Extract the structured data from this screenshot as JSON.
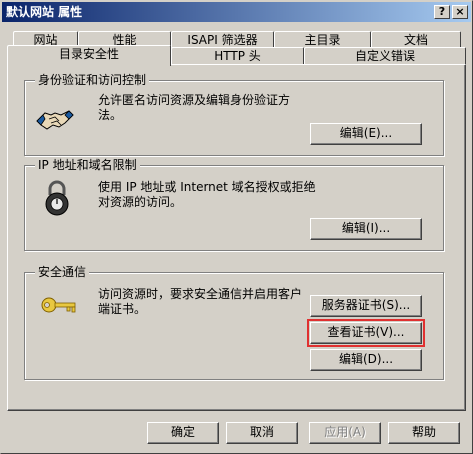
{
  "window": {
    "title": "默认网站 属性",
    "help_btn": "?",
    "close_btn": "×"
  },
  "tabs_row1": [
    "网站",
    "性能",
    "ISAPI 筛选器",
    "主目录",
    "文档"
  ],
  "tabs_row2": [
    "目录安全性",
    "HTTP 头",
    "自定义错误"
  ],
  "groups": {
    "auth": {
      "title": "身份验证和访问控制",
      "desc": "允许匿名访问资源及编辑身份验证方法。",
      "edit_button": "编辑(E)..."
    },
    "ip": {
      "title": "IP 地址和域名限制",
      "desc": "使用 IP 地址或 Internet 域名授权或拒绝对资源的访问。",
      "edit_button": "编辑(I)..."
    },
    "secure": {
      "title": "安全通信",
      "desc": "访问资源时，要求安全通信并启用客户端证书。",
      "server_cert_button": "服务器证书(S)...",
      "view_cert_button": "查看证书(V)...",
      "edit_button": "编辑(D)..."
    }
  },
  "footer": {
    "ok": "确定",
    "cancel": "取消",
    "apply": "应用(A)",
    "help": "帮助"
  },
  "colors": {
    "title_start": "#0a246a",
    "title_end": "#a6caf0",
    "highlight": "#e03030"
  }
}
